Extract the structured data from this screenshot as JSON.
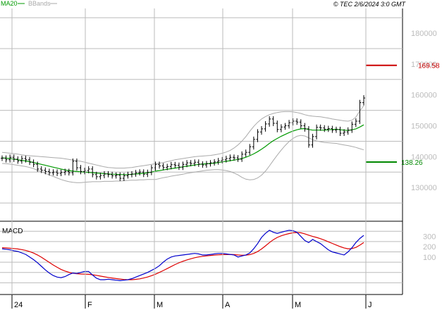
{
  "header": {
    "ma_label": "MA20",
    "bb_label": "BBands",
    "copyright": "© TEC 2/6/2024 3:0 GMT"
  },
  "colors": {
    "price_bar": "#000000",
    "ma20": "#009900",
    "bbands": "#aaaaaa",
    "macd": "#0000cc",
    "signal": "#dd0000",
    "resistance": "#cc0000",
    "support": "#008800",
    "grid": "#bbbbbb"
  },
  "chart_data": [
    {
      "type": "bar",
      "subtype": "ohlc",
      "x_labels": [
        "24",
        "F",
        "M",
        "A",
        "M",
        "J"
      ],
      "ylim": [
        120000,
        188000
      ],
      "y_ticks": [
        130000,
        140000,
        150000,
        160000,
        170000,
        180000
      ],
      "y_tick_labels": [
        "130000",
        "140000",
        "150000",
        "160000",
        "170000",
        "180000"
      ],
      "price_close": [
        139.5,
        139.0,
        139.8,
        139.2,
        138.6,
        139.4,
        139.0,
        138.2,
        137.5,
        136.0,
        135.6,
        135.2,
        134.8,
        135.0,
        134.6,
        134.9,
        135.2,
        134.8,
        138.5,
        136.4,
        135.2,
        135.5,
        136.0,
        134.2,
        133.5,
        133.9,
        134.4,
        134.2,
        133.8,
        134.0,
        133.0,
        133.8,
        134.2,
        134.4,
        134.8,
        135.0,
        134.3,
        134.9,
        136.4,
        137.5,
        137.0,
        136.5,
        136.8,
        137.4,
        137.2,
        136.6,
        137.5,
        138.0,
        137.8,
        138.2,
        137.6,
        137.3,
        137.7,
        138.0,
        138.3,
        138.7,
        139.0,
        139.4,
        139.8,
        139.6,
        139.2,
        140.8,
        141.4,
        143.2,
        145.6,
        148.0,
        149.0,
        150.6,
        152.2,
        150.8,
        148.8,
        149.6,
        150.0,
        151.0,
        151.5,
        151.2,
        150.0,
        149.0,
        143.8,
        146.5,
        149.5,
        149.3,
        148.9,
        149.1,
        148.6,
        148.8,
        147.6,
        148.0,
        148.6,
        150.5,
        151.5,
        157.5,
        159.0
      ],
      "ma20": [
        139.6,
        139.5,
        139.4,
        139.2,
        139.0,
        138.8,
        138.6,
        138.4,
        138.1,
        137.8,
        137.5,
        137.2,
        136.9,
        136.6,
        136.3,
        136.0,
        135.7,
        135.5,
        135.3,
        135.2,
        135.1,
        135.0,
        134.9,
        134.8,
        134.7,
        134.6,
        134.5,
        134.4,
        134.3,
        134.3,
        134.2,
        134.2,
        134.2,
        134.3,
        134.4,
        134.5,
        134.6,
        134.8,
        135.0,
        135.3,
        135.5,
        135.7,
        135.9,
        136.1,
        136.3,
        136.5,
        136.7,
        136.9,
        137.1,
        137.3,
        137.5,
        137.6,
        137.7,
        137.8,
        137.9,
        138.1,
        138.3,
        138.5,
        138.7,
        138.9,
        139.1,
        139.4,
        139.8,
        140.3,
        140.9,
        141.6,
        142.4,
        143.3,
        144.3,
        145.2,
        145.9,
        146.6,
        147.2,
        147.8,
        148.3,
        148.7,
        149.0,
        149.1,
        148.8,
        148.6,
        148.6,
        148.6,
        148.6,
        148.7,
        148.8,
        148.9,
        148.7,
        148.6,
        148.5,
        148.7,
        149.0,
        149.6,
        150.3
      ],
      "bband_upper": [
        141.4,
        141.3,
        141.1,
        141.0,
        140.8,
        140.6,
        140.4,
        140.3,
        140.2,
        140.1,
        140.0,
        139.9,
        139.8,
        139.7,
        139.6,
        139.5,
        139.3,
        139.1,
        138.9,
        138.7,
        138.5,
        138.2,
        137.9,
        137.6,
        137.3,
        137.0,
        136.7,
        136.5,
        136.4,
        136.3,
        136.3,
        136.3,
        136.4,
        136.5,
        136.7,
        136.9,
        137.1,
        137.3,
        137.5,
        137.7,
        137.9,
        138.1,
        138.4,
        138.7,
        139.0,
        139.2,
        139.4,
        139.6,
        139.8,
        140.0,
        140.1,
        140.2,
        140.3,
        140.4,
        140.6,
        140.8,
        141.1,
        141.5,
        142.0,
        142.8,
        143.8,
        145.0,
        146.5,
        148.2,
        149.8,
        151.1,
        152.2,
        153.0,
        153.6,
        154.0,
        154.3,
        154.5,
        154.6,
        154.6,
        154.5,
        154.3,
        154.0,
        153.6,
        153.3,
        153.1,
        153.0,
        152.9,
        152.7,
        152.5,
        152.2,
        152.0,
        151.8,
        151.6,
        151.5,
        151.8,
        152.8,
        154.8,
        156.5
      ],
      "bband_lower": [
        137.8,
        137.7,
        137.6,
        137.4,
        137.2,
        137.0,
        136.8,
        136.5,
        136.1,
        135.6,
        135.1,
        134.6,
        134.1,
        133.6,
        133.1,
        132.6,
        132.2,
        131.9,
        131.7,
        131.6,
        131.6,
        131.7,
        131.8,
        131.9,
        131.9,
        131.9,
        132.0,
        132.0,
        132.0,
        132.1,
        132.1,
        132.2,
        132.3,
        132.4,
        132.4,
        132.5,
        132.5,
        132.6,
        132.6,
        132.6,
        132.9,
        133.2,
        133.4,
        133.7,
        133.9,
        134.1,
        134.3,
        134.6,
        134.8,
        135.0,
        135.2,
        135.4,
        135.6,
        135.7,
        135.8,
        135.8,
        135.7,
        135.5,
        135.2,
        134.7,
        134.1,
        133.3,
        132.7,
        132.5,
        132.6,
        133.1,
        134.0,
        135.3,
        137.0,
        138.8,
        140.5,
        142.1,
        143.6,
        144.9,
        145.9,
        146.6,
        146.9,
        146.7,
        146.1,
        145.5,
        145.1,
        144.8,
        144.6,
        144.5,
        144.4,
        144.3,
        144.0,
        143.8,
        143.6,
        143.3,
        143.0,
        142.6,
        142.2
      ],
      "resistance": {
        "value": 169.58,
        "label": "169.58"
      },
      "support": {
        "value": 138.26,
        "label": "138.26"
      }
    },
    {
      "type": "line",
      "title": "MACD",
      "ylim": [
        -250,
        420
      ],
      "y_ticks": [
        100,
        200,
        300
      ],
      "y_tick_labels": [
        "100",
        "200",
        "300"
      ],
      "series": [
        {
          "values": [
            180,
            175,
            170,
            160,
            155,
            140,
            125,
            100,
            75,
            45,
            10,
            -25,
            -55,
            -80,
            -95,
            -100,
            -90,
            -70,
            -55,
            -60,
            -50,
            -40,
            -40,
            -75,
            -105,
            -120,
            -120,
            -115,
            -120,
            -125,
            -130,
            -125,
            -120,
            -110,
            -95,
            -80,
            -65,
            -50,
            -30,
            -10,
            15,
            50,
            80,
            100,
            110,
            115,
            120,
            125,
            130,
            135,
            130,
            120,
            120,
            125,
            130,
            135,
            135,
            130,
            125,
            120,
            100,
            110,
            120,
            140,
            180,
            230,
            290,
            330,
            360,
            340,
            330,
            340,
            350,
            360,
            355,
            340,
            300,
            260,
            240,
            270,
            250,
            230,
            200,
            170,
            150,
            140,
            130,
            120,
            150,
            190,
            240,
            280,
            310
          ]
        },
        {
          "values": [
            190,
            188,
            185,
            182,
            178,
            172,
            164,
            153,
            138,
            120,
            98,
            73,
            48,
            23,
            0,
            -20,
            -36,
            -48,
            -57,
            -62,
            -65,
            -67,
            -68,
            -72,
            -78,
            -85,
            -92,
            -98,
            -104,
            -109,
            -114,
            -118,
            -120,
            -120,
            -117,
            -112,
            -104,
            -94,
            -81,
            -67,
            -50,
            -31,
            -12,
            8,
            27,
            44,
            59,
            72,
            83,
            93,
            101,
            107,
            111,
            115,
            118,
            121,
            123,
            124,
            125,
            124,
            120,
            118,
            118,
            123,
            135,
            153,
            178,
            208,
            240,
            268,
            290,
            306,
            318,
            328,
            335,
            338,
            335,
            325,
            312,
            300,
            290,
            278,
            264,
            248,
            232,
            216,
            201,
            188,
            180,
            182,
            193,
            215,
            240
          ]
        }
      ]
    }
  ]
}
